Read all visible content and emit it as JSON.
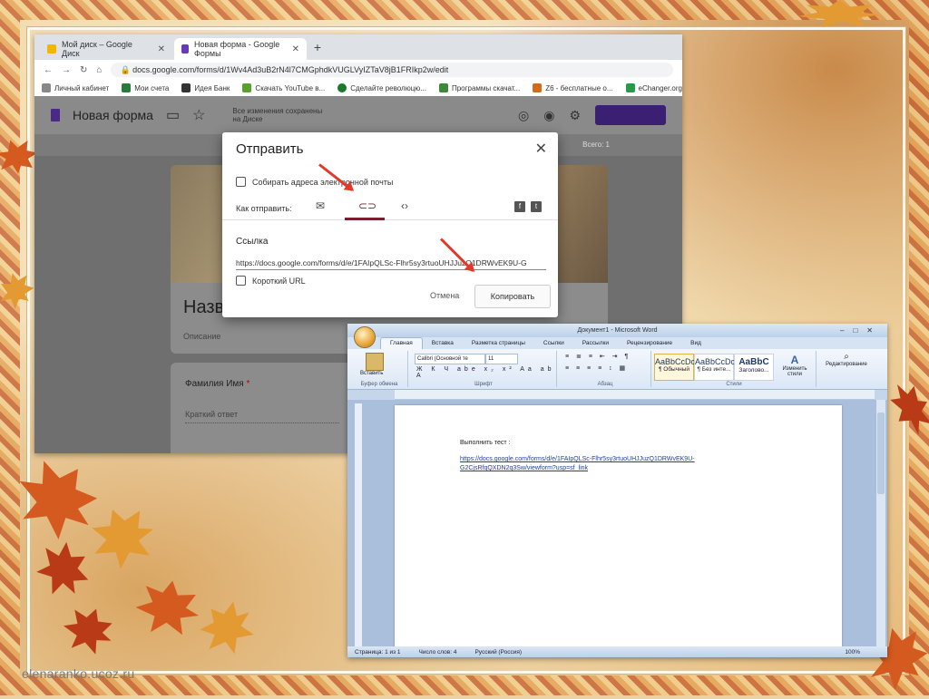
{
  "slide": {
    "watermark": "elenaranko.ucoz.ru"
  },
  "browser": {
    "tabs": [
      {
        "label": "Мой диск – Google Диск",
        "favicon_color": "#f4b400"
      },
      {
        "label": "Новая форма - Google Формы",
        "favicon_color": "#673ab7"
      }
    ],
    "new_tab": "+",
    "url": "docs.google.com/forms/d/1Wv4Ad3uB2rN4l7CMGphdkVUGLVyIZTaV8jB1FRIkp2w/edit",
    "bookmarks": [
      "Личный кабинет",
      "Мои счета",
      "Идея Банк",
      "Скачать YouTube в...",
      "Сделайте революцю...",
      "Программы скачат...",
      "Z6 - бесплатные о...",
      "eChanger.org - Libe..."
    ]
  },
  "forms": {
    "title": "Новая форма",
    "saved_note": "Все изменения сохранены на Диске",
    "form_title": "Название теста",
    "form_description": "Описание",
    "question": "Фамилия Имя",
    "required_mark": "*",
    "answer_placeholder": "Краткий ответ",
    "points": "Всего: 1"
  },
  "dialog": {
    "title": "Отправить",
    "close": "✕",
    "collect_emails": "Собирать адреса электронной почты",
    "how_to_send": "Как отправить:",
    "link_label": "Ссылка",
    "link_url": "https://docs.google.com/forms/d/e/1FAIpQLSc-Flhr5sy3rtuoUHJJuzQ1DRWvEK9U-G",
    "short_url": "Короткий URL",
    "cancel": "Отмена",
    "copy": "Копировать"
  },
  "word": {
    "title": "Документ1 - Microsoft Word",
    "tabs": [
      "Главная",
      "Вставка",
      "Разметка страницы",
      "Ссылки",
      "Рассылки",
      "Рецензирование",
      "Вид"
    ],
    "font_name": "Calibri (Основной те",
    "font_size": "11",
    "paste_label": "Вставить",
    "groups": [
      "Буфер обмена",
      "Шрифт",
      "Абзац",
      "Стили"
    ],
    "styles": [
      {
        "sample": "AaBbCcDc",
        "name": "¶ Обычный"
      },
      {
        "sample": "AaBbCcDc",
        "name": "¶ Без инте..."
      },
      {
        "sample": "AaBbC",
        "name": "Заголово..."
      }
    ],
    "change_styles": "Изменить стили",
    "editing": "Редактирование",
    "doc_heading": "Выполнить тест :",
    "doc_link": "https://docs.google.com/forms/d/e/1FAIpQLSc-Flhr5sy3rtuoUHJJuzQ1DRWvEK9U-G2CjsRfqQXDN2q3Sw/viewform?usp=sf_link",
    "status_page": "Страница: 1 из 1",
    "status_words": "Число слов: 4",
    "status_lang": "Русский (Россия)",
    "zoom": "100%"
  }
}
